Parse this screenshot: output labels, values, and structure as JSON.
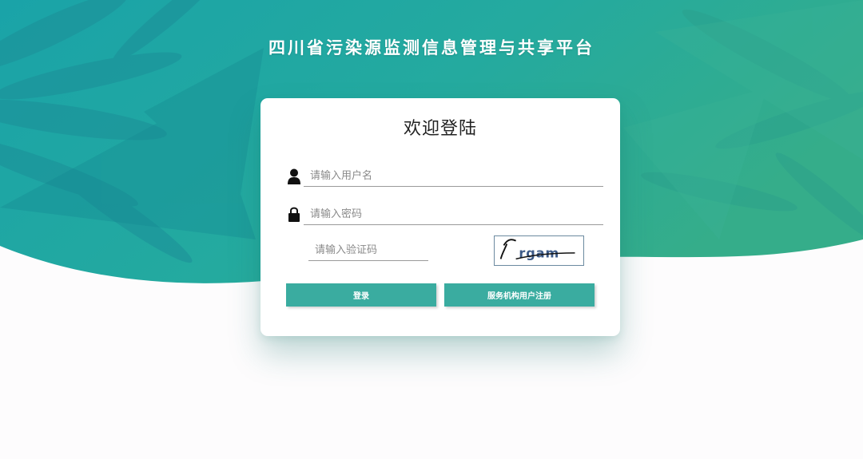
{
  "header": {
    "title": "四川省污染源监测信息管理与共享平台"
  },
  "login": {
    "title": "欢迎登陆",
    "username_placeholder": "请输入用户名",
    "password_placeholder": "请输入密码",
    "captcha_placeholder": "请输入验证码",
    "captcha_text": "rgam",
    "login_label": "登录",
    "register_label": "服务机构用户注册"
  },
  "icons": {
    "user": "user-icon",
    "lock": "lock-icon"
  },
  "colors": {
    "banner_start": "#1aa3a8",
    "banner_end": "#35ad8a",
    "button": "#3aaca0",
    "page_background": "#fdfcfd"
  }
}
